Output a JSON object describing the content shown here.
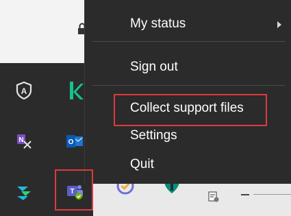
{
  "menu": {
    "items": [
      {
        "label": "My status",
        "has_submenu": true
      },
      {
        "label": "Sign out",
        "has_submenu": false
      },
      {
        "label": "Collect support files",
        "has_submenu": false,
        "highlighted": true
      },
      {
        "label": "Settings",
        "has_submenu": false
      },
      {
        "label": "Quit",
        "has_submenu": false
      }
    ]
  },
  "tray": {
    "icons": [
      "shield-a-icon",
      "k-app-icon",
      "onenote-clip-icon",
      "outlook-icon",
      "stack-app-icon",
      "teams-icon",
      "check-circle-icon",
      "leaf-app-icon"
    ],
    "highlighted_icon": "teams-icon"
  },
  "colors": {
    "menu_background": "#2b2b2b",
    "menu_text": "#ffffff",
    "highlight": "#e0393e",
    "teams": "#5b5fc7",
    "k_app": "#14c38e"
  }
}
